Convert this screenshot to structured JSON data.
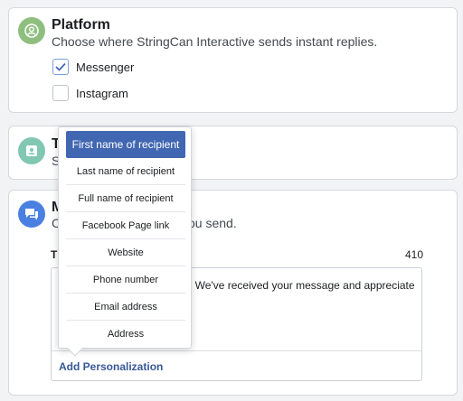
{
  "platform": {
    "title": "Platform",
    "description": "Choose where StringCan Interactive sends instant replies.",
    "options": [
      {
        "label": "Messenger",
        "checked": true
      },
      {
        "label": "Instagram",
        "checked": false
      }
    ]
  },
  "tone": {
    "title_partial": "T",
    "desc_partial": "S"
  },
  "message": {
    "title_partial": "M",
    "desc_partial_left": "C",
    "desc_partial_right": "ou send.",
    "label_partial": "T",
    "char_count": "410",
    "text_visible": ". We've received your message and appreciate",
    "add_personalization_label": "Add Personalization"
  },
  "personalization_menu": {
    "items": [
      "First name of recipient",
      "Last name of recipient",
      "Full name of recipient",
      "Facebook Page link",
      "Website",
      "Phone number",
      "Email address",
      "Address"
    ],
    "active_index": 0
  },
  "colors": {
    "platform_icon_bg": "#8fbf7f",
    "tone_icon_bg": "#82c7b1",
    "message_icon_bg": "#4a80e0",
    "accent": "#4267b2",
    "link": "#385898"
  }
}
